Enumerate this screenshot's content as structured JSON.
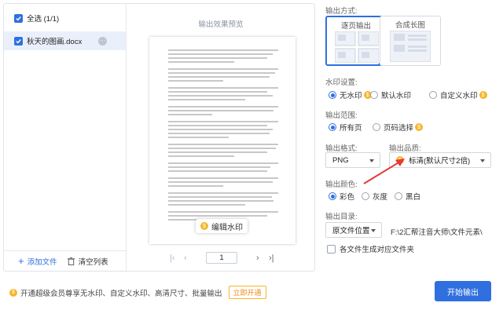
{
  "file_list": {
    "select_all_label": "全选 (1/1)",
    "files": [
      {
        "name": "秋天的图画.docx"
      }
    ],
    "add_file_label": "添加文件",
    "clear_list_label": "清空列表"
  },
  "preview": {
    "title": "输出效果预览",
    "edit_watermark_label": "编辑水印",
    "page_number": "1"
  },
  "output_mode": {
    "label": "输出方式:",
    "options": [
      {
        "label": "逐页输出",
        "selected": true
      },
      {
        "label": "合成长图",
        "selected": false
      }
    ]
  },
  "watermark": {
    "label": "水印设置:",
    "options": [
      {
        "label": "无水印",
        "selected": true,
        "badge": true
      },
      {
        "label": "默认水印",
        "selected": false,
        "badge": false
      },
      {
        "label": "自定义水印",
        "selected": false,
        "badge": true
      }
    ]
  },
  "range": {
    "label": "输出范围:",
    "options": [
      {
        "label": "所有页",
        "selected": true
      },
      {
        "label": "页码选择",
        "selected": false,
        "badge": true
      }
    ]
  },
  "format": {
    "label": "输出格式:",
    "value": "PNG"
  },
  "quality": {
    "label": "输出品质:",
    "value": "标清(默认尺寸2倍)"
  },
  "color": {
    "label": "输出颜色:",
    "options": [
      {
        "label": "彩色",
        "selected": true
      },
      {
        "label": "灰度",
        "selected": false
      },
      {
        "label": "黑白",
        "selected": false
      }
    ]
  },
  "directory": {
    "label": "输出目录:",
    "select_value": "原文件位置",
    "path": "F:\\2汇帮注音大师\\文件元素\\",
    "checkbox_label": "各文件生成对应文件夹"
  },
  "footer": {
    "promo_text": "开通超级会员尊享无水印、自定义水印、高清尺寸、批量输出",
    "open_label": "立即开通",
    "start_button": "开始输出"
  },
  "colors": {
    "accent": "#2f6fe0",
    "gold": "#f6b52a",
    "arrow": "#e53935"
  },
  "icons": [
    "check-icon",
    "more-icon",
    "plus-icon",
    "trash-icon",
    "first-page-icon",
    "prev-page-icon",
    "next-page-icon",
    "last-page-icon",
    "coin-icon",
    "caret-down-icon"
  ]
}
